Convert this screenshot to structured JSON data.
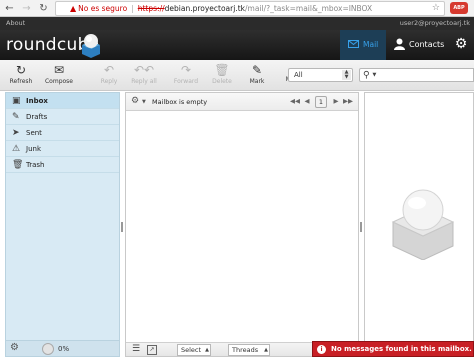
{
  "browser": {
    "insecure_label": "No es seguro",
    "url_scheme": "https://",
    "url_host": "debian.proyectoarj.tk",
    "url_path": "/mail/?_task=mail&_mbox=INBOX",
    "extension_badge": "ABP"
  },
  "topbar": {
    "about": "About",
    "user": "user2@proyectoarj.tk"
  },
  "header": {
    "logo": "roundcube",
    "nav_mail": "Mail",
    "nav_contacts": "Contacts"
  },
  "toolbar": {
    "refresh": "Refresh",
    "compose": "Compose",
    "reply": "Reply",
    "reply_all": "Reply all",
    "forward": "Forward",
    "delete": "Delete",
    "mark": "Mark",
    "more": "More",
    "filter_value": "All"
  },
  "folders": [
    {
      "label": "Inbox",
      "icon": "inbox-icon"
    },
    {
      "label": "Drafts",
      "icon": "pencil-icon"
    },
    {
      "label": "Sent",
      "icon": "sent-icon"
    },
    {
      "label": "Junk",
      "icon": "junk-icon"
    },
    {
      "label": "Trash",
      "icon": "trash-icon"
    }
  ],
  "quota": {
    "text": "0%"
  },
  "messagelist": {
    "status": "Mailbox is empty",
    "page": "1",
    "select_label": "Select",
    "threads_label": "Threads"
  },
  "notification": {
    "text": "No messages found in this mailbox."
  },
  "colors": {
    "accent": "#37a1ea",
    "error": "#c81f25",
    "folder_bg": "#d8eaf4"
  }
}
